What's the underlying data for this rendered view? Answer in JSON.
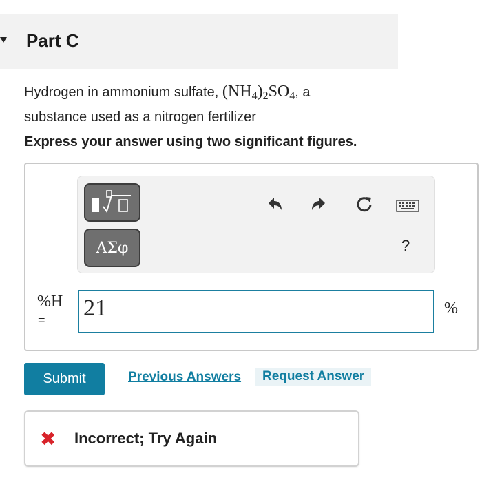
{
  "part": {
    "title": "Part C"
  },
  "question": {
    "text_before": "Hydrogen in ammonium sulfate, ",
    "formula_open": "(NH",
    "formula_sub1": "4",
    "formula_mid": ")",
    "formula_sub2": "2",
    "formula_so": "SO",
    "formula_sub3": "4",
    "text_after_formula": ", a",
    "text_line2": "substance used as a nitrogen fertilizer",
    "instruction": "Express your answer using two significant figures."
  },
  "toolbar": {
    "templates_icon": "math-templates-icon",
    "symbols_label": "ΑΣφ",
    "undo_icon": "undo-icon",
    "redo_icon": "redo-icon",
    "reset_icon": "reset-icon",
    "keyboard_icon": "keyboard-icon",
    "help_label": "?"
  },
  "answer": {
    "variable_label": "%H",
    "equals": "=",
    "value": "21",
    "unit": "%"
  },
  "actions": {
    "submit_label": "Submit",
    "previous_answers_label": "Previous Answers",
    "request_answer_label": "Request Answer"
  },
  "feedback": {
    "icon": "x-icon",
    "icon_glyph": "✖",
    "message": "Incorrect; Try Again",
    "status_color": "#d8232a"
  },
  "colors": {
    "accent": "#117ea1",
    "header_bg": "#f2f2f2",
    "tool_button_bg": "#6f6f6f"
  }
}
